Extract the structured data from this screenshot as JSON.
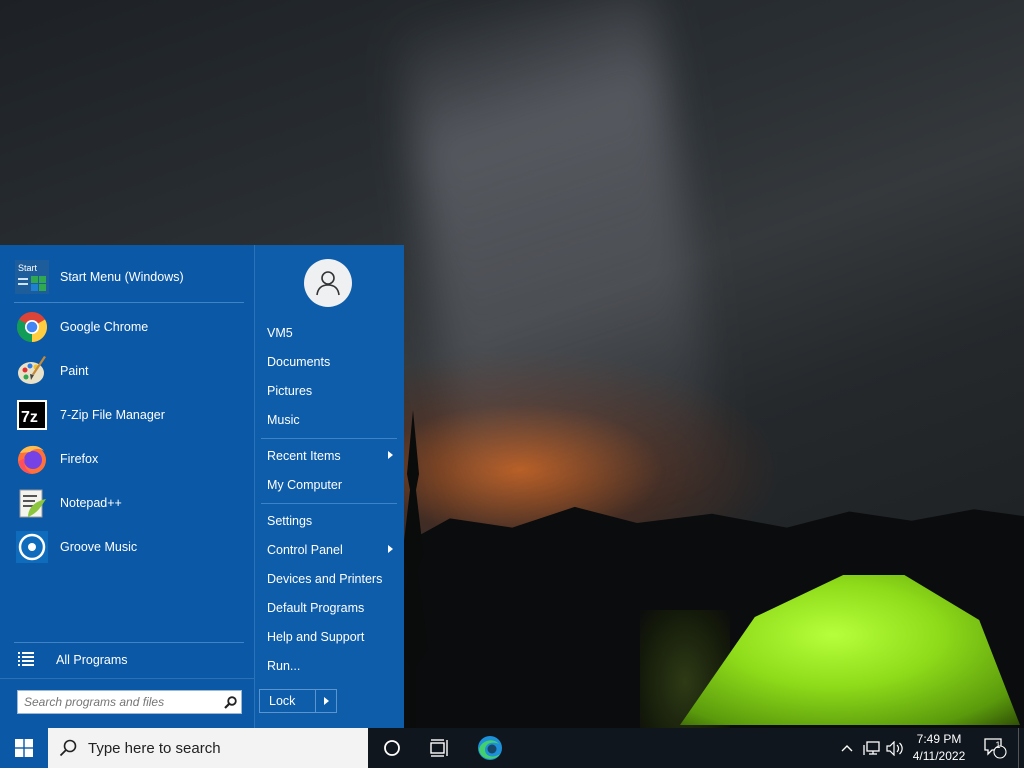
{
  "start_menu": {
    "pinned": [
      {
        "label": "Start Menu (Windows)",
        "icon": "start-menu-app-icon"
      },
      {
        "label": "Google Chrome",
        "icon": "chrome-icon"
      },
      {
        "label": "Paint",
        "icon": "paint-icon"
      },
      {
        "label": "7-Zip File Manager",
        "icon": "7zip-icon"
      },
      {
        "label": "Firefox",
        "icon": "firefox-icon"
      },
      {
        "label": "Notepad++",
        "icon": "notepadpp-icon"
      },
      {
        "label": "Groove Music",
        "icon": "groove-music-icon"
      }
    ],
    "start_icon_text": "Start",
    "sevenzip_icon_text": "7z",
    "all_programs": "All Programs",
    "search_placeholder": "Search programs and files",
    "right_items": {
      "user": "VM5",
      "documents": "Documents",
      "pictures": "Pictures",
      "music": "Music",
      "recent_items": "Recent Items",
      "my_computer": "My Computer",
      "settings": "Settings",
      "control_panel": "Control Panel",
      "devices_printers": "Devices and Printers",
      "default_programs": "Default Programs",
      "help_support": "Help and Support",
      "run": "Run..."
    },
    "lock_label": "Lock"
  },
  "taskbar": {
    "search_placeholder": "Type here to search",
    "time": "7:49 PM",
    "date": "4/11/2022",
    "notification_count": "1"
  },
  "colors": {
    "menu_bg": "#0a58a6",
    "taskbar_bg": "#10161d"
  }
}
